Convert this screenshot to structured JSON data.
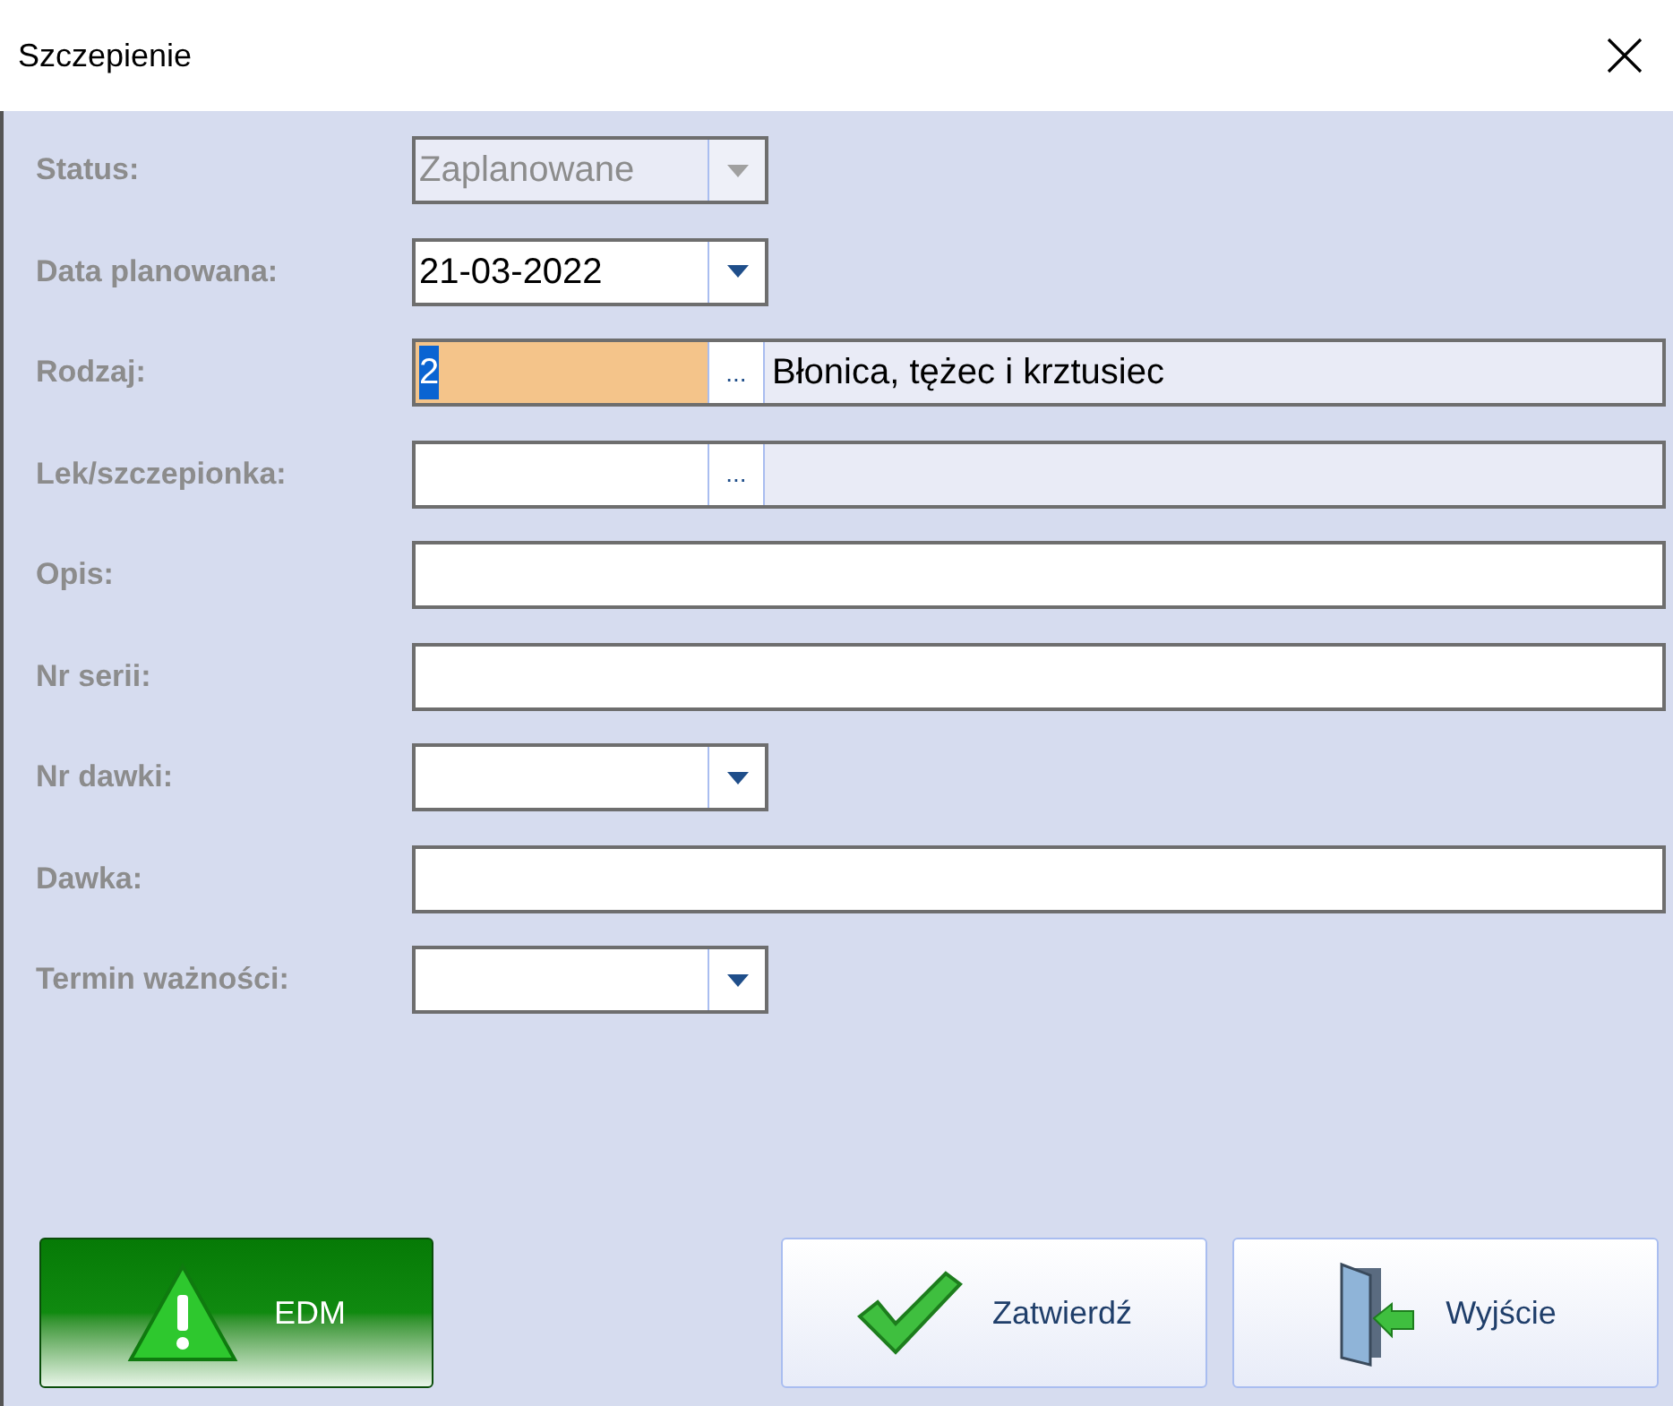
{
  "window": {
    "title": "Szczepienie"
  },
  "fields": [
    {
      "label": "Status:",
      "kind": "combo",
      "value": "Zaplanowane",
      "disabled": true
    },
    {
      "label": "Data planowana:",
      "kind": "combo",
      "value": "21-03-2022",
      "disabled": false
    },
    {
      "label": "Rodzaj:",
      "kind": "lookup",
      "code": "2",
      "code_selected": true,
      "focused": true,
      "button": "...",
      "description": "Błonica, tężec i krztusiec"
    },
    {
      "label": "Lek/szczepionka:",
      "kind": "lookup",
      "focused": false,
      "button": "..."
    },
    {
      "label": "Opis:",
      "kind": "text"
    },
    {
      "label": "Nr serii:",
      "kind": "text"
    },
    {
      "label": "Nr dawki:",
      "kind": "combo",
      "disabled": false
    },
    {
      "label": "Dawka:",
      "kind": "text"
    },
    {
      "label": "Termin ważności:",
      "kind": "combo",
      "disabled": false
    }
  ],
  "buttons": [
    {
      "label": "EDM",
      "kind": "warning"
    },
    {
      "label": "Zatwierdź",
      "kind": "check"
    },
    {
      "label": "Wyjście",
      "kind": "exit"
    }
  ]
}
